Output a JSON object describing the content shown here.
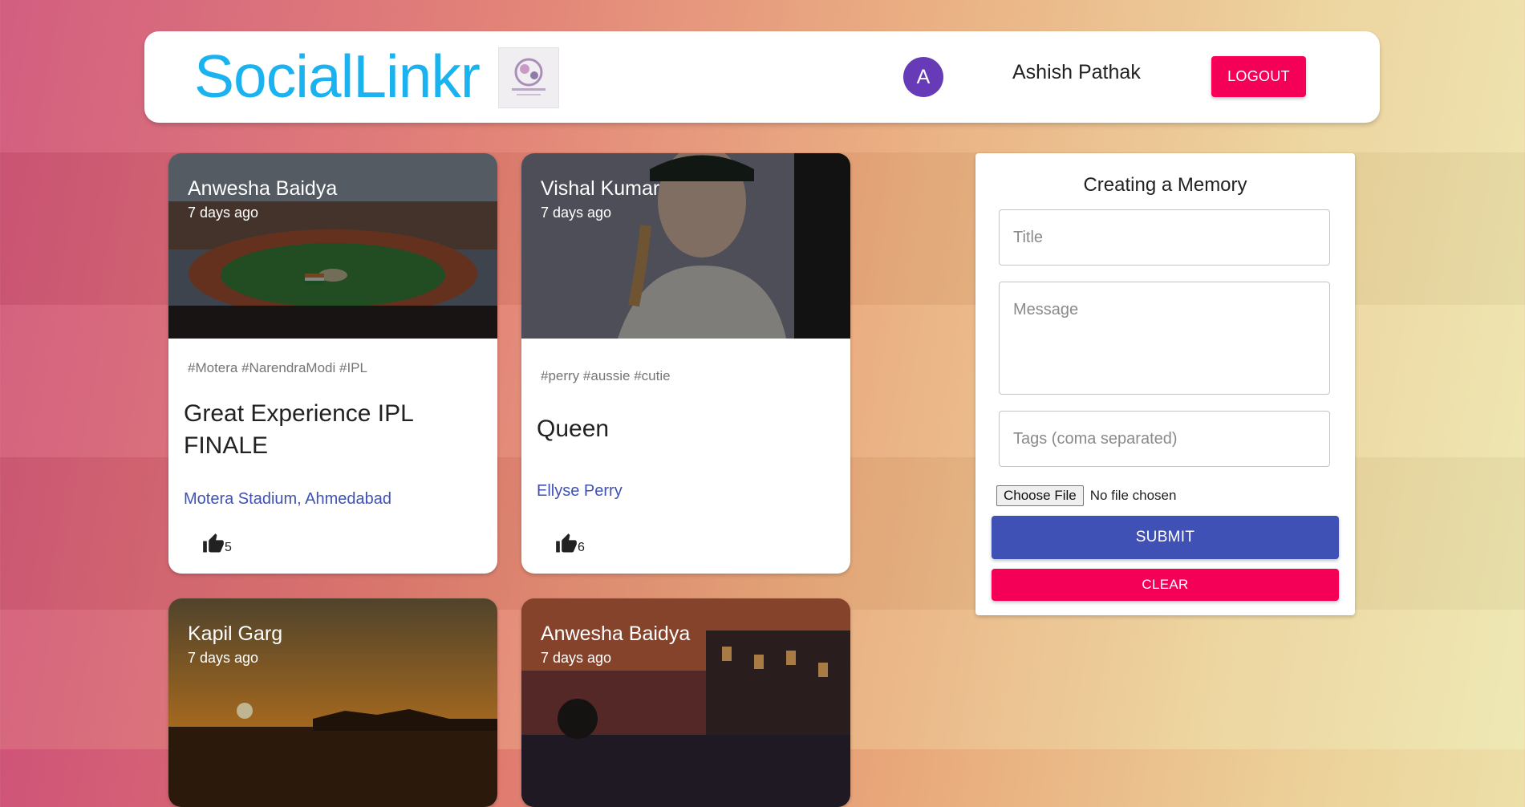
{
  "app": {
    "brand": "SocialLinkr",
    "user_initial": "A",
    "user_name": "Ashish Pathak",
    "logout_label": "LOGOUT"
  },
  "posts": [
    {
      "author": "Anwesha Baidya",
      "time": "7 days ago",
      "tags": "#Motera #NarendraModi #IPL",
      "title": "Great Experience IPL FINALE",
      "message": "Motera Stadium, Ahmedabad",
      "likes": "5",
      "image": "stadium"
    },
    {
      "author": "Vishal Kumar",
      "time": "7 days ago",
      "tags": "#perry #aussie #cutie",
      "title": "Queen",
      "message": "Ellyse Perry",
      "likes": "6",
      "image": "cricketer"
    },
    {
      "author": "Kapil Garg",
      "time": "7 days ago",
      "image": "sunset"
    },
    {
      "author": "Anwesha Baidya",
      "time": "7 days ago",
      "image": "canal-city"
    }
  ],
  "form": {
    "heading": "Creating a Memory",
    "title_placeholder": "Title",
    "message_placeholder": "Message",
    "tags_placeholder": "Tags (coma separated)",
    "file_button": "Choose File",
    "file_status": "No file chosen",
    "submit_label": "SUBMIT",
    "clear_label": "CLEAR"
  },
  "colors": {
    "brand": "#1ab3ef",
    "primary": "#3f51b5",
    "secondary": "#f50057",
    "avatar": "#673ab7"
  }
}
